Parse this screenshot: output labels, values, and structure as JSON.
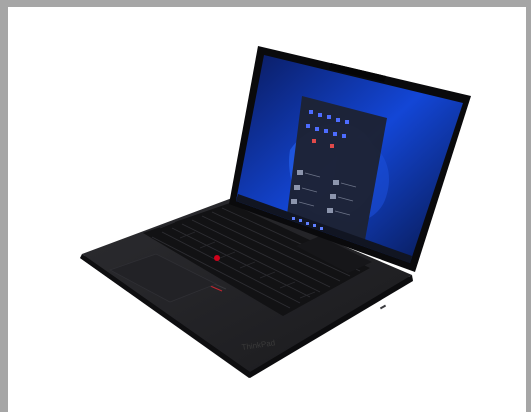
{
  "image": {
    "subject": "laptop-product-photo",
    "brand_mark": "ThinkPad",
    "colors": {
      "frame_border": "#a6a6a6",
      "background": "#ffffff",
      "chassis": "#1c1c1e",
      "keyboard_deck": "#26262a",
      "keys": "#141416",
      "trackpoint": "#d0021b",
      "screen_bezel": "#0b0b0d",
      "wallpaper": "#0c2a8a",
      "start_menu": "#1d2233",
      "taskbar": "#111522"
    }
  }
}
